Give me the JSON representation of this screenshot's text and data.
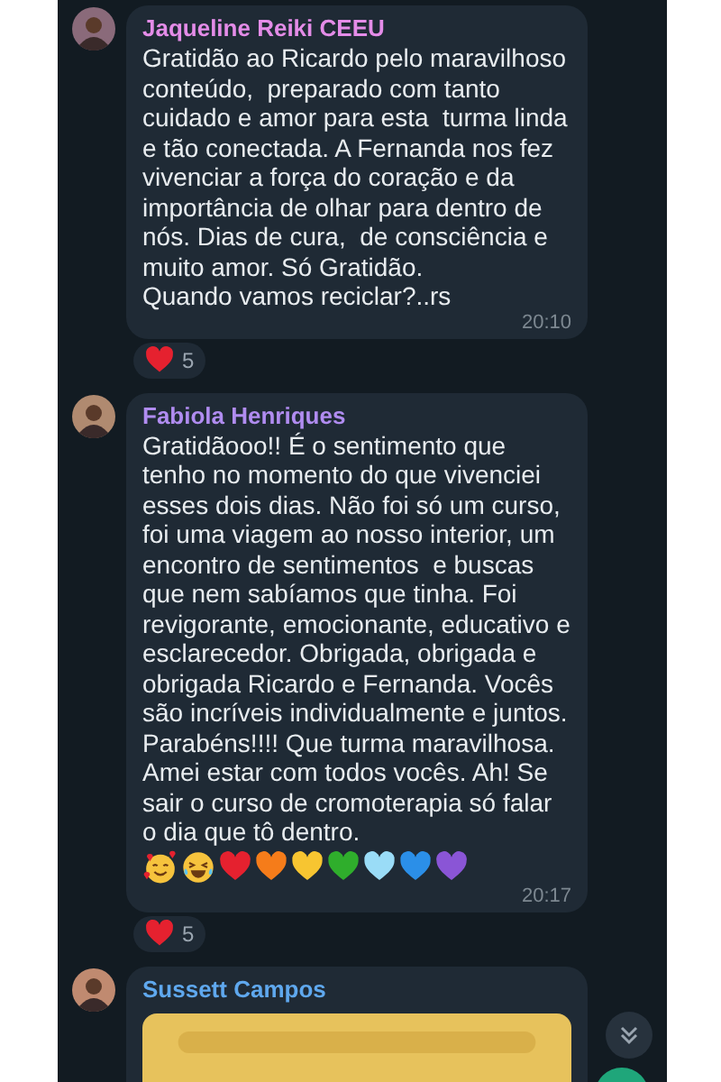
{
  "messages": [
    {
      "sender": "Jaqueline Reiki CEEU",
      "color": "#e48ce8",
      "text": "Gratidão ao Ricardo pelo maravilhoso conteúdo,  preparado com tanto cuidado e amor para esta  turma linda e tão conectada. A Fernanda nos fez vivenciar a força do coração e da importância de olhar para dentro de nós. Dias de cura,  de consciência e muito amor. Só Gratidão.\nQuando vamos reciclar?..rs",
      "time": "20:10",
      "reaction_count": "5"
    },
    {
      "sender": "Fabiola Henriques",
      "color": "#b08cf0",
      "text": "Gratidãooo!! É o sentimento que tenho no momento do que vivenciei esses dois dias. Não foi só um curso, foi uma viagem ao nosso interior, um encontro de sentimentos  e buscas que nem sabíamos que tinha. Foi revigorante, emocionante, educativo e esclarecedor. Obrigada, obrigada e obrigada Ricardo e Fernanda. Vocês são incríveis individualmente e juntos. Parabéns!!!! Que turma maravilhosa. Amei estar com todos vocês. Ah! Se sair o curso de cromoterapia só falar o dia que tô dentro.",
      "emojis": [
        {
          "kind": "face_hearts"
        },
        {
          "kind": "face_laughing"
        },
        {
          "kind": "heart",
          "color": "#e5212f"
        },
        {
          "kind": "heart",
          "color": "#f57c1a"
        },
        {
          "kind": "heart",
          "color": "#f7c531"
        },
        {
          "kind": "heart",
          "color": "#2fae2c"
        },
        {
          "kind": "heart",
          "color": "#9adcf7"
        },
        {
          "kind": "heart",
          "color": "#2b8fe8"
        },
        {
          "kind": "heart",
          "color": "#8a55d6"
        }
      ],
      "time": "20:17",
      "reaction_count": "5"
    },
    {
      "sender": "Sussett Campos",
      "color": "#5fa8ee"
    }
  ]
}
